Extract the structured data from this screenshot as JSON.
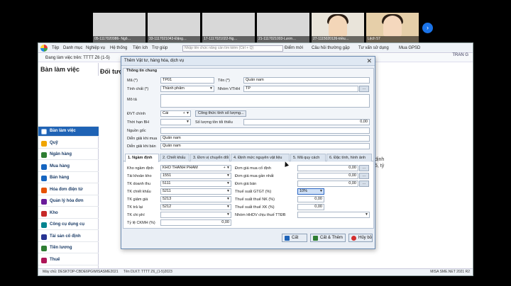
{
  "video": {
    "tiles": [
      "05-1117020986- Ngô…",
      "33-1117021043-Đặng…",
      "17-1117021022-Ng…",
      "21-1117021003-Lươn…",
      "27-1115020126-triều…",
      "Lệch 57"
    ],
    "next": "›"
  },
  "menubar": {
    "items": [
      "Tệp",
      "Danh mục",
      "Nghiệp vụ",
      "Hệ thống",
      "Tiện ích",
      "Trợ giúp"
    ],
    "search_placeholder": "Nhập tên chức năng cần tìm kiếm (Ctrl + Q)",
    "links": [
      "Điểm mới",
      "Câu hỏi thường gặp",
      "Tư vấn sử dụng",
      "Mua GPSD"
    ],
    "working_period": "Đang làm việc trên: TTTT Z6 (1-5)",
    "user": "TRAN G"
  },
  "sidebar": {
    "title": "Bàn làm việc",
    "items": [
      {
        "label": "Bàn làm việc",
        "color": "#ffffff"
      },
      {
        "label": "Quỹ",
        "color": "#f0a500"
      },
      {
        "label": "Ngân hàng",
        "color": "#2e7d32"
      },
      {
        "label": "Mua hàng",
        "color": "#1565c0"
      },
      {
        "label": "Bán hàng",
        "color": "#1565c0"
      },
      {
        "label": "Hóa đơn điện tử",
        "color": "#e65100"
      },
      {
        "label": "Quản lý hóa đơn",
        "color": "#6a1b9a"
      },
      {
        "label": "Kho",
        "color": "#c62828"
      },
      {
        "label": "Công cụ dụng cụ",
        "color": "#00838f"
      },
      {
        "label": "Tài sản cố định",
        "color": "#283593"
      },
      {
        "label": "Tiền lương",
        "color": "#2e7d32"
      },
      {
        "label": "Thuế",
        "color": "#ad1457"
      }
    ]
  },
  "main": {
    "title": "Đối tượ",
    "bg_lines": [
      "dịnh",
      "5, tỷ"
    ]
  },
  "statusbar": {
    "machine": "Máy chủ: DESKTOP-CBDE6PG\\MISASME2021",
    "db": "Tên DLKT: TTTT Z6_(1-5)2023",
    "version": "MISA SME.NET 2021 R2"
  },
  "dialog": {
    "title": "Thêm Vật tư, hàng hóa, dịch vụ",
    "close": "✕",
    "group_label": "Thông tin chung",
    "fields": {
      "ma_label": "Mã (*)",
      "ma": "TP01",
      "ten_label": "Tên (*)",
      "ten": "Quần nam",
      "tinhchat_label": "Tính chất (*)",
      "tinhchat": "Thành phẩm",
      "nhom_label": "Nhóm VTHH",
      "nhom": "TP",
      "mota_label": "Mô tả",
      "dvt_label": "ĐVT chính",
      "dvt": "Cái",
      "ct_button": "Công thức tính số lượng...",
      "thoihan_label": "Thời hạn BH",
      "sltoithieu_label": "Số lượng tồn tối thiểu",
      "sltoithieu": "0,00",
      "nguongoc_label": "Nguồn gốc",
      "dgmua_label": "Diễn giải khi mua",
      "dgmua": "Quần nam",
      "dgban_label": "Diễn giải khi bán",
      "dgban": "Quần nam"
    },
    "tabs": [
      "1. Ngầm định",
      "2. Chiết khấu",
      "3. Đơn vị chuyển đổi",
      "4. Định mức nguyên vật liệu",
      "5. Mã quy cách",
      "6. Đặc tính, hình ảnh"
    ],
    "tab1": {
      "kho_label": "Kho ngầm định",
      "kho": "KHO THÀNH PHẨM",
      "tkkho_label": "Tài khoản kho",
      "tkkho": "1551",
      "tkdt_label": "TK doanh thu",
      "tkdt": "5111",
      "tkck_label": "TK chiết khấu",
      "tkck": "5211",
      "tkgg_label": "TK giảm giá",
      "tkgg": "5213",
      "tktl_label": "TK trả lại",
      "tktl": "5212",
      "tkcp_label": "TK chi phí",
      "tkcp": "",
      "tlckmh_label": "Tỷ lệ CKMH (%)",
      "tlckmh": "0,00",
      "dgmuacd_label": "Đơn giá mua cố định",
      "dgmuacd": "0,00",
      "dgmuagn_label": "Đơn giá mua gần nhất",
      "dgmuagn": "0,00",
      "dgban_label": "Đơn giá bán",
      "dgban": "0,00",
      "gtgt_label": "Thuế suất GTGT (%)",
      "gtgt": "10%",
      "nk_label": "Thuế suất thuế NK (%)",
      "nk": "0,00",
      "xk_label": "Thuế suất thuế XK (%)",
      "xk": "0,00",
      "ttdb_label": "Nhóm HHDV chịu thuế TTĐB",
      "ttdb": ""
    },
    "buttons": {
      "cat": "Cất",
      "catthem": "Cất & Thêm",
      "huybo": "Hủy bỏ"
    }
  }
}
